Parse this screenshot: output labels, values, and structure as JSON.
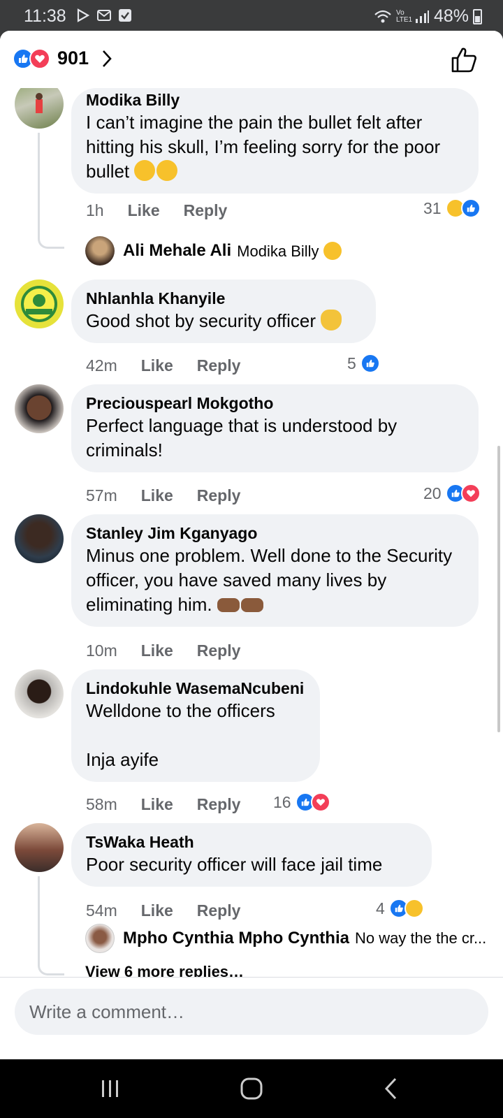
{
  "status_bar": {
    "time": "11:38",
    "battery": "48%",
    "network": "Vo LTE1"
  },
  "header": {
    "reaction_count": "901"
  },
  "comments": [
    {
      "name": "Modika Billy",
      "text": "I can’t imagine the pain the bullet felt after hitting his skull, I’m feeling sorry for the poor bullet",
      "time": "1h",
      "like": "Like",
      "reply": "Reply",
      "reactions": "31",
      "reply_preview": {
        "name": "Ali Mehale Ali",
        "text": "Modika Billy"
      }
    },
    {
      "name": "Nhlanhla Khanyile",
      "text": "Good shot by security officer",
      "time": "42m",
      "like": "Like",
      "reply": "Reply",
      "reactions": "5"
    },
    {
      "name": "Preciouspearl Mokgotho",
      "text": "Perfect language that is understood by criminals!",
      "time": "57m",
      "like": "Like",
      "reply": "Reply",
      "reactions": "20"
    },
    {
      "name": "Stanley Jim Kganyago",
      "text": "Minus one problem. Well done to the Security officer, you have saved many lives by eliminating him.",
      "time": "10m",
      "like": "Like",
      "reply": "Reply"
    },
    {
      "name": "Lindokuhle WasemaNcubeni",
      "text": "Welldone to the officers\n\nInja ayife",
      "time": "58m",
      "like": "Like",
      "reply": "Reply",
      "reactions": "16"
    },
    {
      "name": "TsWaka Heath",
      "text": "Poor security officer will face jail time",
      "time": "54m",
      "like": "Like",
      "reply": "Reply",
      "reactions": "4",
      "reply_preview": {
        "name": "Mpho Cynthia Mpho Cynthia",
        "text": "No way the the cr..."
      },
      "more_replies": "View 6 more replies…"
    }
  ],
  "composer": {
    "placeholder": "Write a comment…"
  },
  "colors": {
    "like_blue": "#1877f2",
    "love_red": "#f33e58",
    "bubble_bg": "#f0f2f5",
    "meta_gray": "#65676b"
  }
}
